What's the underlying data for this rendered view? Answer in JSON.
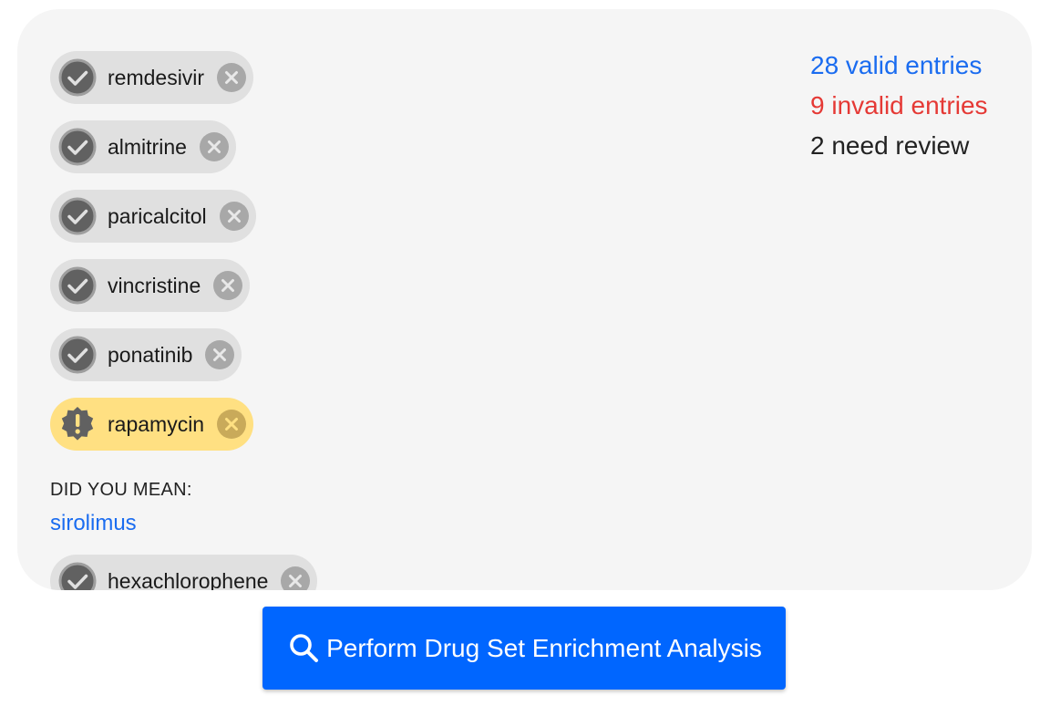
{
  "colors": {
    "panel_bg": "#f5f5f5",
    "chip_bg": "#e0e0e0",
    "chip_warn_bg": "#ffe082",
    "link_blue": "#1a6cf0",
    "error_red": "#e53935",
    "button_blue": "#0066ff"
  },
  "entries": [
    {
      "label": "remdesivir",
      "status": "valid",
      "icon": "check-circle-icon"
    },
    {
      "label": "almitrine",
      "status": "valid",
      "icon": "check-circle-icon"
    },
    {
      "label": "paricalcitol",
      "status": "valid",
      "icon": "check-circle-icon"
    },
    {
      "label": "vincristine",
      "status": "valid",
      "icon": "check-circle-icon"
    },
    {
      "label": "ponatinib",
      "status": "valid",
      "icon": "check-circle-icon"
    },
    {
      "label": "rapamycin",
      "status": "review",
      "icon": "warning-badge-icon"
    },
    {
      "label": "hexachlorophene",
      "status": "valid",
      "icon": "check-circle-icon"
    }
  ],
  "suggestion": {
    "heading": "DID YOU MEAN:",
    "link": "sirolimus"
  },
  "stats": {
    "valid": "28 valid entries",
    "invalid": "9 invalid entries",
    "review": "2 need review"
  },
  "action": {
    "label": "Perform Drug Set Enrichment Analysis",
    "icon": "search-icon"
  }
}
